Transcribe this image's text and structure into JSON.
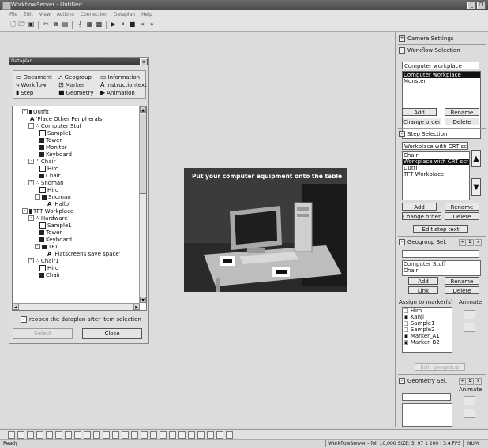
{
  "window": {
    "title": "WorkflowServer - Untitled",
    "minimize": "_",
    "restore": "❐"
  },
  "menu": [
    "File",
    "Edit",
    "View",
    "Actions",
    "Connection",
    "Dataplan",
    "Help"
  ],
  "dialog": {
    "title": "Dataplan",
    "close": "x",
    "legend": {
      "document": "Document",
      "geogroup": "Geogroup",
      "information": "Information",
      "workflow": "Workflow",
      "marker": "Marker",
      "instructiontext": "Instructiontext",
      "step": "Step",
      "geometry": "Geometry",
      "animation": "Animation"
    },
    "tree": [
      "Outfit",
      "'Place Other Peripherals'",
      "Computer Stuf",
      "Sample1",
      "Tower",
      "Monitor",
      "Keyboard",
      "Chair",
      "Hiro",
      "Chair",
      "Snoman",
      "Hiro",
      "Snoman",
      "'Hallo'",
      "TFT Workplace",
      "Hardware",
      "Sample1",
      "Tower",
      "Keyboard",
      "TFT",
      "'Flatscreens save space'",
      "Chair1",
      "Hiro",
      "Chair"
    ],
    "reopen_label": "reopen the dataplan after item selection",
    "reopen_checked": "✓",
    "select_button": "Select",
    "close_button": "Close"
  },
  "camera": {
    "overlay_text": "Put your computer equipment onto the table"
  },
  "right": {
    "camera_settings": "Camera Settings",
    "workflow_selection": "Workflow Selection",
    "workflow_input": "Computer workplace",
    "workflow_list": [
      "Computer workplace",
      "Monster"
    ],
    "add": "Add",
    "rename": "Rename",
    "change_order": "Change order",
    "delete": "Delete",
    "step_selection": "Step Selection",
    "step_input": "Workplace with CRT scr",
    "step_list": [
      "Chair",
      "Workplace with CRT scr",
      "Dutti",
      "TFT Workplace"
    ],
    "up_arrow": "▲",
    "down_arrow": "▼",
    "edit_step_text": "Edit step text",
    "geogroup_sel": "Geogroup Sel.",
    "geogroup_list": [
      "Computer Stuff",
      "Chair"
    ],
    "link": "Link",
    "assign_markers": "Assign to marker(s)",
    "animate": "Animate",
    "marker_list": [
      "Hiro",
      "Kanji",
      "Sample1",
      "Sample2",
      "Marker_A1",
      "Marker_B2"
    ],
    "edit_geogroup": "Edit geogroup",
    "geometry_sel": "Geometry Sel.",
    "geometry_animate": "Animate"
  },
  "status": {
    "left": "Ready",
    "info": "WorkflowServer - fol: 10,000 SIZE: 3,  97 1 200 :   3.4 FPS",
    "num": "NUM"
  }
}
